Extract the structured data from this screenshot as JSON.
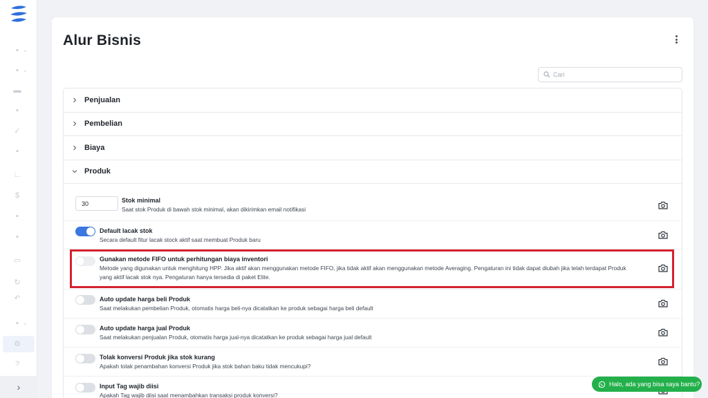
{
  "page": {
    "title": "Alur Bisnis"
  },
  "search": {
    "placeholder": "Cari"
  },
  "sections": [
    {
      "label": "Penjualan",
      "expanded": false
    },
    {
      "label": "Pembelian",
      "expanded": false
    },
    {
      "label": "Biaya",
      "expanded": false
    },
    {
      "label": "Produk",
      "expanded": true
    }
  ],
  "settings": {
    "stok_minimal": {
      "value": "30",
      "title": "Stok minimal",
      "desc": "Saat stok Produk di bawah stok minimal, akan dikirimkan email notifikasi"
    },
    "default_lacak_stok": {
      "enabled": true,
      "title": "Default lacak stok",
      "desc": "Secara default fitur lacak stock aktif saat membuat Produk baru"
    },
    "fifo": {
      "enabled": false,
      "title": "Gunakan metode FIFO untuk perhitungan biaya inventori",
      "desc_line1": "Metode yang digunakan untuk menghitung HPP. Jika aktif akan menggunakan metode FIFO, jika tidak aktif akan menggunakan metode Averaging. Pengaturan ini tidak dapat diubah jika telah terdapat Produk",
      "desc_line2": "yang aktif lacak stok nya. Pengaturan hanya tersedia di paket Elite."
    },
    "auto_harga_beli": {
      "enabled": false,
      "title": "Auto update harga beli Produk",
      "desc": "Saat melakukan pembelian Produk, otomatis harga beli-nya dicatatkan ke produk sebagai harga beli default"
    },
    "auto_harga_jual": {
      "enabled": false,
      "title": "Auto update harga jual Produk",
      "desc": "Saat melakukan penjualan Produk, otomatis harga jual-nya dicatatkan ke produk sebagai harga jual default"
    },
    "tolak_konversi": {
      "enabled": false,
      "title": "Tolak konversi Produk jika stok kurang",
      "desc": "Apakah tolak penambahan konversi Produk jika stok bahan baku tidak mencukupi?"
    },
    "input_tag": {
      "enabled": false,
      "title": "Input Tag wajib diisi",
      "desc": "Apakah Tag wajib diisi saat menambahkan transaksi produk konversi?"
    }
  },
  "chat": {
    "label": "Halo, ada yang bisa saya bantu?"
  },
  "colors": {
    "primary": "#3b76e1",
    "highlight": "#d6202d",
    "chat": "#23b04b"
  },
  "icons": {
    "sidebar": [
      "app-logo-icon",
      "shopping-bag-icon",
      "shopping-bag-icon",
      "wallet-icon",
      "users-icon",
      "check-icon",
      "briefcase-icon",
      "chart-icon",
      "dollar-icon",
      "calculator-icon",
      "building-icon",
      "id-card-icon",
      "refresh-icon",
      "undo-icon",
      "report-icon",
      "settings-icon",
      "help-icon",
      "expand-icon"
    ],
    "row_action": "camera-icon"
  }
}
